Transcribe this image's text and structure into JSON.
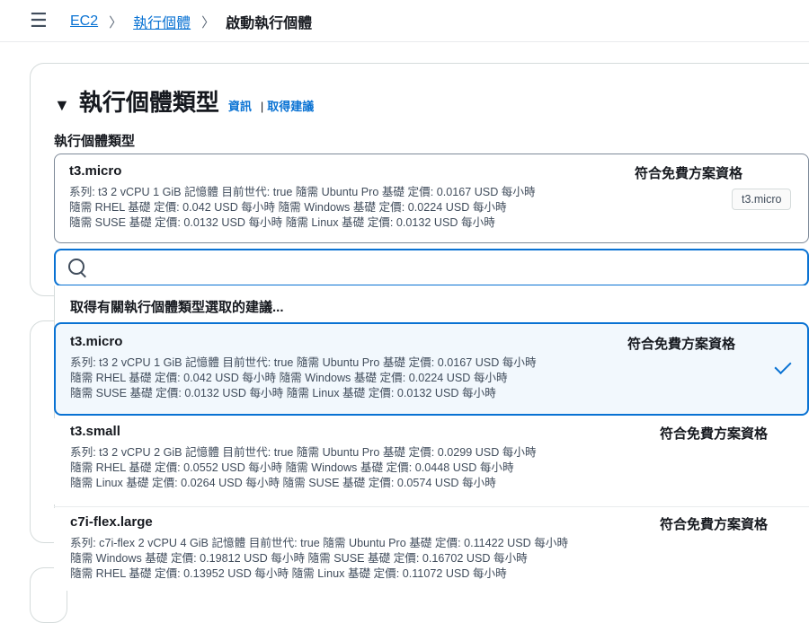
{
  "breadcrumb": {
    "items": [
      "EC2",
      "執行個體"
    ],
    "current": "啟動執行個體"
  },
  "section": {
    "title": "執行個體類型",
    "info_link": "資訊",
    "separator": "|",
    "recommend_link": "取得建議",
    "field_label": "執行個體類型"
  },
  "selected": {
    "name": "t3.micro",
    "free_tier": "符合免費方案資格",
    "lines": [
      "系列: t3    2 vCPU    1 GiB 記憶體    目前世代: true    隨需 Ubuntu Pro 基礎 定價: 0.0167 USD 每小時",
      "隨需 RHEL 基礎 定價: 0.042 USD 每小時    隨需 Windows 基礎 定價: 0.0224 USD 每小時",
      "隨需 SUSE 基礎 定價: 0.0132 USD 每小時    隨需 Linux 基礎 定價: 0.0132 USD 每小時"
    ],
    "tooltip": "t3.micro"
  },
  "search": {
    "value": "",
    "placeholder": ""
  },
  "suggest_text": "取得有關執行個體類型選取的建議...",
  "options": [
    {
      "name": "t3.micro",
      "free_tier": "符合免費方案資格",
      "lines": [
        "系列: t3    2 vCPU    1 GiB 記憶體    目前世代: true    隨需 Ubuntu Pro 基礎 定價: 0.0167 USD 每小時",
        "隨需 RHEL 基礎 定價: 0.042 USD 每小時    隨需 Windows 基礎 定價: 0.0224 USD 每小時",
        "隨需 SUSE 基礎 定價: 0.0132 USD 每小時    隨需 Linux 基礎 定價: 0.0132 USD 每小時"
      ]
    },
    {
      "name": "t3.small",
      "free_tier": "符合免費方案資格",
      "lines": [
        "系列: t3    2 vCPU    2 GiB 記憶體    目前世代: true    隨需 Ubuntu Pro 基礎 定價: 0.0299 USD 每小時",
        "隨需 RHEL 基礎 定價: 0.0552 USD 每小時    隨需 Windows 基礎 定價: 0.0448 USD 每小時",
        "隨需 Linux 基礎 定價: 0.0264 USD 每小時    隨需 SUSE 基礎 定價: 0.0574 USD 每小時"
      ]
    },
    {
      "name": "c7i-flex.large",
      "free_tier": "符合免費方案資格",
      "lines": [
        "系列: c7i-flex    2 vCPU    4 GiB 記憶體    目前世代: true    隨需 Ubuntu Pro 基礎 定價: 0.11422 USD 每小時",
        "隨需 Windows 基礎 定價: 0.19812 USD 每小時    隨需 SUSE 基礎 定價: 0.16702 USD 每小時",
        "隨需 RHEL 基礎 定價: 0.13952 USD 每小時    隨需 Linux 基礎 定價: 0.11072 USD 每小時"
      ]
    }
  ],
  "colors": {
    "link": "#0972d3",
    "text": "#16191f",
    "secondary": "#414d5c",
    "selected_bg": "#f2f8fd"
  }
}
